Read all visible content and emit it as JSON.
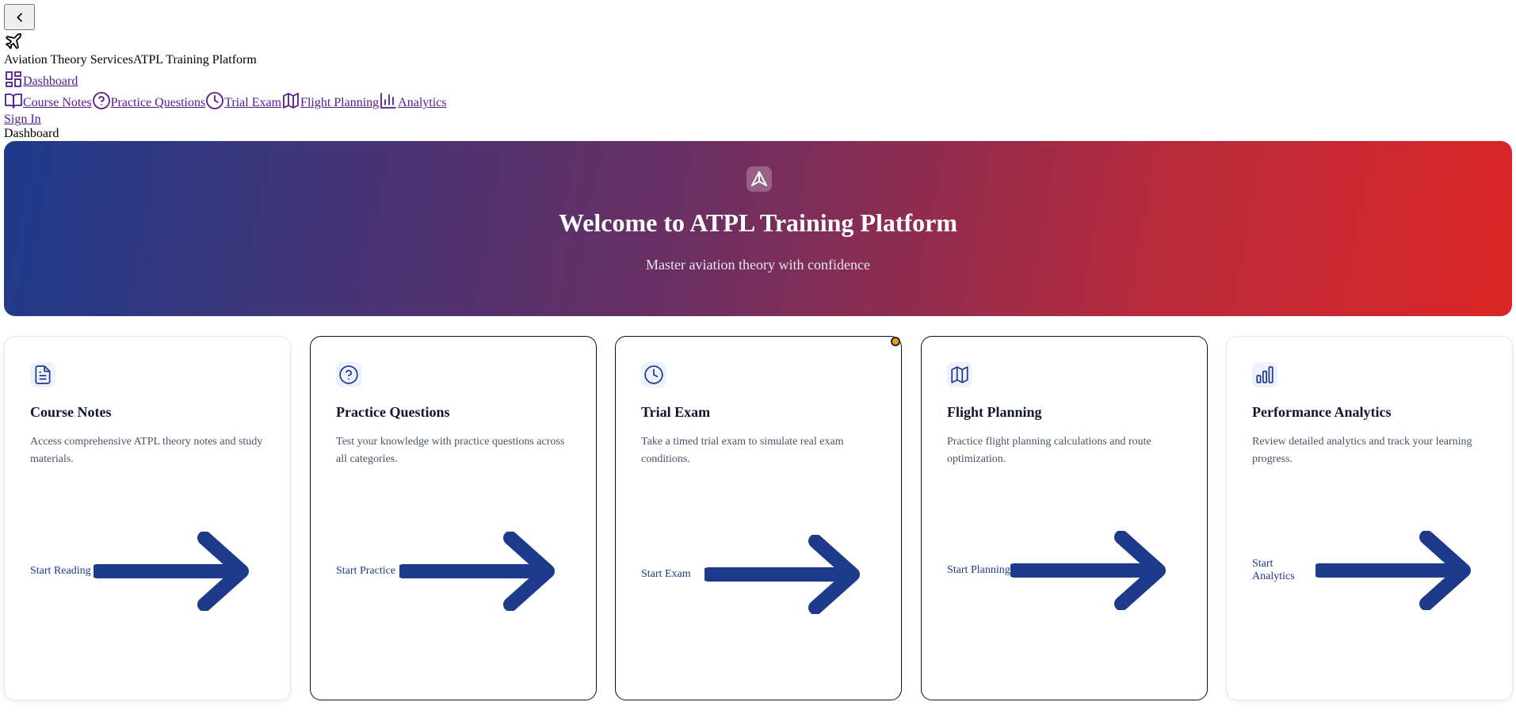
{
  "header": {
    "back_icon": "chevron-left-icon",
    "logo_icon": "plane-icon",
    "brand_company": "Aviation Theory Services",
    "brand_product": "ATPL Training Platform"
  },
  "nav": {
    "items": [
      {
        "label": "Dashboard",
        "icon": "dashboard-grid-icon"
      },
      {
        "label": "Course Notes",
        "icon": "book-open-icon"
      },
      {
        "label": "Practice Questions",
        "icon": "help-circle-icon"
      },
      {
        "label": "Trial Exam",
        "icon": "clock-icon"
      },
      {
        "label": "Flight Planning",
        "icon": "map-icon"
      },
      {
        "label": "Analytics",
        "icon": "bar-chart-icon"
      }
    ],
    "sign_in": "Sign In"
  },
  "breadcrumb": "Dashboard",
  "hero": {
    "icon": "navigation-triangle-icon",
    "title": "Welcome to ATPL Training Platform",
    "subtitle": "Master aviation theory with confidence",
    "gradient_colors": [
      "#1e3a8a",
      "#dc2626"
    ]
  },
  "cards": [
    {
      "title": "Course Notes",
      "description": "Access comprehensive ATPL theory notes and study materials.",
      "cta": "Start Reading",
      "icon": "file-text-icon"
    },
    {
      "title": "Practice Questions",
      "description": "Test your knowledge with practice questions across all categories.",
      "cta": "Start Practice",
      "icon": "help-circle-icon"
    },
    {
      "title": "Trial Exam",
      "description": "Take a timed trial exam to simulate real exam conditions.",
      "cta": "Start Exam",
      "icon": "clock-icon"
    },
    {
      "title": "Flight Planning",
      "description": "Practice flight planning calculations and route optimization.",
      "cta": "Start Planning",
      "icon": "map-icon"
    },
    {
      "title": "Performance Analytics",
      "description": "Review detailed analytics and track your learning progress.",
      "cta": "Start Analytics",
      "icon": "bar-chart-icon"
    }
  ],
  "colors": {
    "accent": "#1e3a8a",
    "link": "#551a8b",
    "card_text": "#475569"
  }
}
